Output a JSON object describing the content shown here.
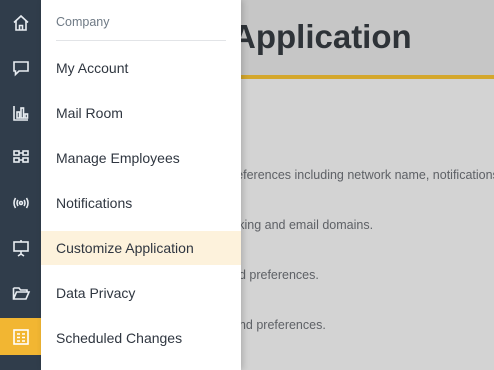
{
  "rail": {
    "items": [
      {
        "icon": "home-icon"
      },
      {
        "icon": "chat-icon"
      },
      {
        "icon": "analytics-icon"
      },
      {
        "icon": "apps-grid-icon"
      },
      {
        "icon": "broadcast-icon"
      },
      {
        "icon": "presentation-board-icon"
      },
      {
        "icon": "folder-icon"
      },
      {
        "icon": "company-settings-icon"
      }
    ],
    "active_color": "#f2b632",
    "background": "#303d4b"
  },
  "page": {
    "title": "Application",
    "descriptions": [
      "references including network name, notifications,",
      "cking and email domains.",
      "nd preferences.",
      "and preferences."
    ],
    "accent_color": "#d4a72c"
  },
  "menu": {
    "heading": "Company",
    "items": [
      {
        "label": "My Account"
      },
      {
        "label": "Mail Room"
      },
      {
        "label": "Manage Employees"
      },
      {
        "label": "Notifications"
      },
      {
        "label": "Customize Application"
      },
      {
        "label": "Data Privacy"
      },
      {
        "label": "Scheduled Changes"
      }
    ],
    "highlight_color": "#fdf2dc"
  }
}
